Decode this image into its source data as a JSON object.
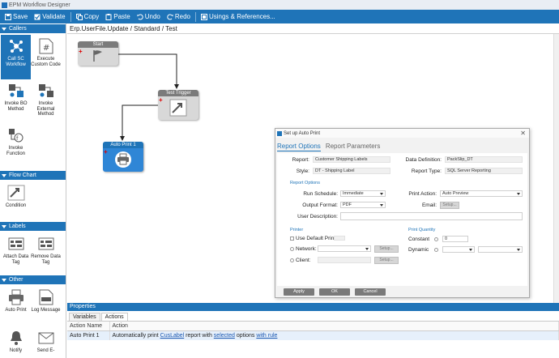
{
  "window": {
    "title": "EPM Workflow Designer"
  },
  "toolbar": {
    "save": "Save",
    "validate": "Validate",
    "copy": "Copy",
    "paste": "Paste",
    "undo": "Undo",
    "redo": "Redo",
    "usings": "Usings & References..."
  },
  "sidebar": {
    "sections": [
      {
        "title": "Callers",
        "items": [
          "Call SC Workflow",
          "Execute Custom Code",
          "Invoke BO Method",
          "Invoke External Method",
          "Invoke Function"
        ]
      },
      {
        "title": "Flow Chart",
        "items": [
          "Condition"
        ]
      },
      {
        "title": "Labels",
        "items": [
          "Attach Data Tag",
          "Remove Data Tag"
        ]
      },
      {
        "title": "Other",
        "items": [
          "Auto Print",
          "Log Message",
          "Notify",
          "Send E-"
        ]
      }
    ]
  },
  "canvas": {
    "breadcrumb": "Erp.UserFile.Update / Standard / Test",
    "nodes": {
      "start": "Start",
      "trigger": "Test Trigger",
      "autoprint": "Auto Print 1"
    }
  },
  "dialog": {
    "title": "Set up Auto Print",
    "tabs": [
      "Report Options",
      "Report Parameters"
    ],
    "report_label": "Report:",
    "report_value": "Customer Shipping Labels",
    "style_label": "Style:",
    "style_value": "DT - Shipping Label",
    "data_def_label": "Data Definition:",
    "data_def_value": "PackSlip_DT",
    "report_type_label": "Report Type:",
    "report_type_value": "SQL Server Reporting",
    "report_options_section": "Report Options",
    "run_schedule_label": "Run Schedule:",
    "run_schedule_value": "Immediate",
    "print_action_label": "Print Action:",
    "print_action_value": "Auto Preview",
    "output_format_label": "Output Format:",
    "output_format_value": "PDF",
    "email_label": "Email:",
    "setup_label": "Setup...",
    "user_desc_label": "User Description:",
    "printer_section": "Printer",
    "use_default_printer": "Use Default Printer",
    "network_label": "Network:",
    "client_label": "Client:",
    "print_quantity_section": "Print Quantity",
    "constant_label": "Constant",
    "constant_value": "0",
    "dynamic_label": "Dynamic",
    "apply": "Apply",
    "ok": "OK",
    "cancel": "Cancel"
  },
  "properties": {
    "header": "Properties",
    "tabs": [
      "Variables",
      "Actions"
    ],
    "columns": [
      "Action Name",
      "Action"
    ],
    "row": {
      "name": "Auto Print 1",
      "text1": "Automatically print ",
      "link1": "CusLabel",
      "text2": " report with ",
      "link2": "selected",
      "text3": " options ",
      "link3": "with rule"
    }
  }
}
